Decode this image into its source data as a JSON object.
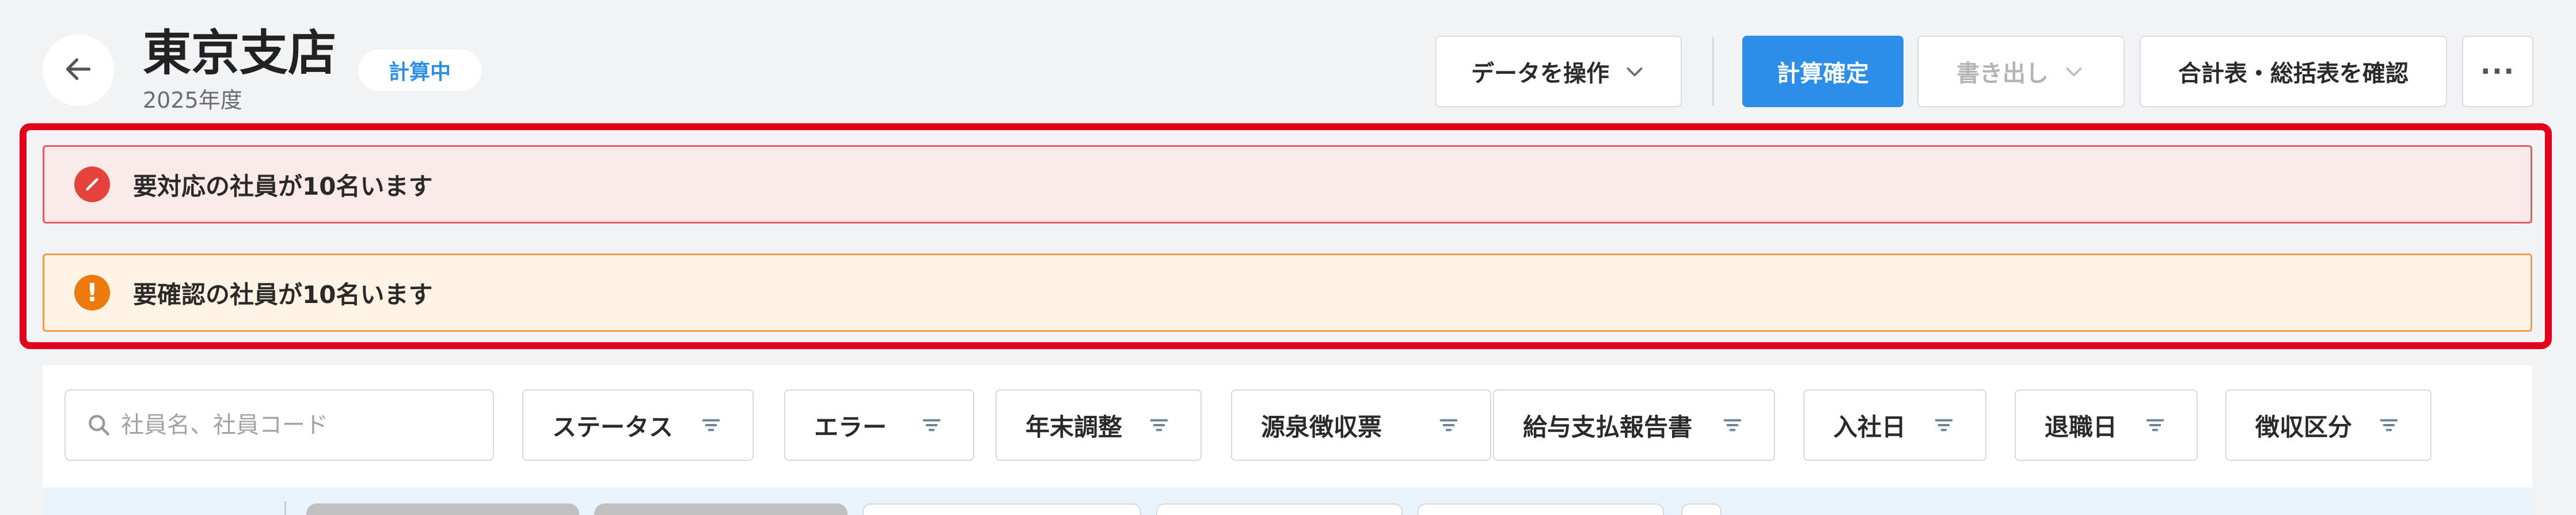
{
  "header": {
    "title": "東京支店",
    "subtitle": "2025年度",
    "status_badge": "計算中"
  },
  "toolbar": {
    "data_ops_label": "データを操作",
    "confirm_label": "計算確定",
    "export_label": "書き出し",
    "summary_label": "合計表・総括表を確認",
    "more_label": "···"
  },
  "alerts": {
    "error_text": "要対応の社員が10名います",
    "warning_text": "要確認の社員が10名います"
  },
  "filters": {
    "search_placeholder": "社員名、社員コード",
    "chips": [
      "ステータス",
      "エラー",
      "年末調整",
      "源泉徴収票",
      "給与支払報告書",
      "入社日",
      "退職日",
      "徴収区分"
    ]
  },
  "colors": {
    "primary": "#2d8eea",
    "error": "#e5413d",
    "warning": "#ec7a0d",
    "highlight_frame": "#e2001a"
  }
}
